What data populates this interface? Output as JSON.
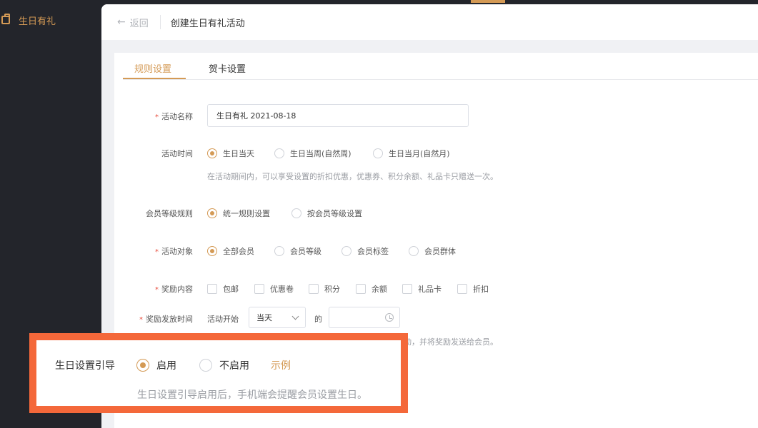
{
  "sidebar": {
    "items": [
      {
        "label": "生日有礼",
        "icon": "gift-icon"
      }
    ]
  },
  "header": {
    "back_label": "返回",
    "title": "创建生日有礼活动"
  },
  "tabs": [
    {
      "label": "规则设置",
      "active": true
    },
    {
      "label": "贺卡设置",
      "active": false
    }
  ],
  "form": {
    "activity_name": {
      "label": "活动名称",
      "required": true,
      "value": "生日有礼  2021-08-18"
    },
    "activity_time": {
      "label": "活动时间",
      "options": [
        "生日当天",
        "生日当周(自然周)",
        "生日当月(自然月)"
      ],
      "selected": "生日当天",
      "hint": "在活动期间内，可以享受设置的折扣优惠，优惠券、积分余额、礼品卡只赠送一次。"
    },
    "member_level_rule": {
      "label": "会员等级规则",
      "options": [
        "统一规则设置",
        "按会员等级设置"
      ],
      "selected": "统一规则设置"
    },
    "target": {
      "label": "活动对象",
      "required": true,
      "options": [
        "全部会员",
        "会员等级",
        "会员标签",
        "会员群体"
      ],
      "selected": "全部会员"
    },
    "rewards": {
      "label": "奖励内容",
      "required": true,
      "options": [
        "包邮",
        "优惠卷",
        "积分",
        "余额",
        "礼品卡",
        "折扣"
      ]
    },
    "reward_time": {
      "label": "奖励发放时间",
      "required": true,
      "prefix": "活动开始",
      "select_value": "当天",
      "of_label": "的",
      "hint_tail": "动，并将奖励发送给会员。"
    }
  },
  "highlight": {
    "label": "生日设置引导",
    "options": [
      "启用",
      "不启用"
    ],
    "selected": "启用",
    "example_label": "示例",
    "hint": "生日设置引导启用后，手机端会提醒会员设置生日。"
  },
  "colors": {
    "accent": "#d49a55",
    "highlight_border": "#f4683a",
    "sidebar_bg": "#23252b"
  }
}
